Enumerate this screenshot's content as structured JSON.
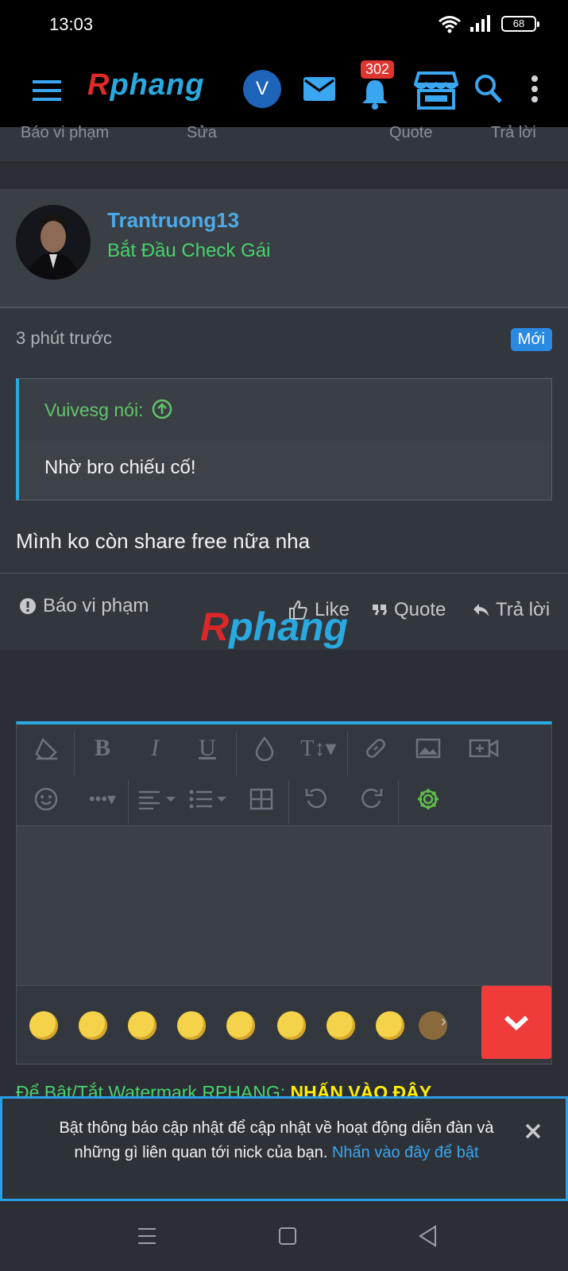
{
  "status_bar": {
    "time": "13:03",
    "battery": "68"
  },
  "header": {
    "logo_r": "R",
    "logo_rest": "phang",
    "avatar_letter": "V",
    "notification_count": "302"
  },
  "prev_post_actions": {
    "report": "Báo vi phạm",
    "edit": "Sửa",
    "quote": "Quote",
    "reply": "Trả lời"
  },
  "post": {
    "username": "Trantruong13",
    "user_title": "Bắt Đầu Check Gái",
    "time": "3 phút trước",
    "new_badge": "Mới",
    "quote_author": "Vuivesg nói:",
    "quote_text": "Nhờ bro chiếu cố!",
    "message": "Mình ko còn share free nữa nha",
    "actions": {
      "report": "Báo vi phạm",
      "like": "Like",
      "quote": "Quote",
      "reply": "Trả lời"
    },
    "watermark_r": "R",
    "watermark_rest": "phang"
  },
  "editor": {
    "emoji_count_visible": 9
  },
  "watermark_hint": {
    "text": "Để Bật/Tắt Watermark RPHANG: ",
    "cta": "NHẤN VÀO ĐÂY"
  },
  "push_notice": {
    "text": "Bật thông báo cập nhật để cập nhật về hoạt động diễn đàn và những gì liên quan tới nick của bạn.",
    "link": "Nhấn vào đây để bật"
  },
  "colors": {
    "accent": "#2aa9e0",
    "username": "#4fa9e8",
    "user_title": "#47d36b",
    "badge_red": "#e0342e",
    "new_badge": "#2a8ae2",
    "collapse_button": "#f03b3b"
  }
}
